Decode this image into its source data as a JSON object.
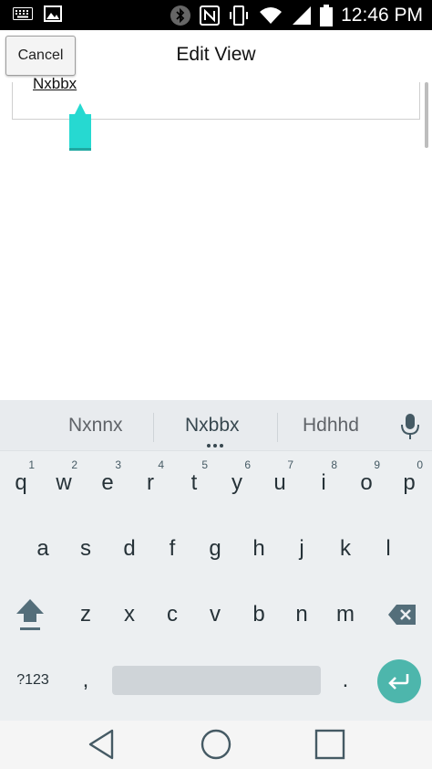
{
  "status_bar": {
    "time": "12:46 PM",
    "icons": [
      "keyboard-icon",
      "image-icon",
      "bluetooth-icon",
      "nfc-icon",
      "vibrate-icon",
      "wifi-icon",
      "signal-icon",
      "battery-icon"
    ]
  },
  "header": {
    "cancel_label": "Cancel",
    "title": "Edit View"
  },
  "editor": {
    "text": "Nxbbx"
  },
  "keyboard": {
    "suggestions": [
      "Nxnnx",
      "Nxbbx",
      "Hdhhd"
    ],
    "row1": [
      {
        "key": "q",
        "hint": "1"
      },
      {
        "key": "w",
        "hint": "2"
      },
      {
        "key": "e",
        "hint": "3"
      },
      {
        "key": "r",
        "hint": "4"
      },
      {
        "key": "t",
        "hint": "5"
      },
      {
        "key": "y",
        "hint": "6"
      },
      {
        "key": "u",
        "hint": "7"
      },
      {
        "key": "i",
        "hint": "8"
      },
      {
        "key": "o",
        "hint": "9"
      },
      {
        "key": "p",
        "hint": "0"
      }
    ],
    "row2": [
      "a",
      "s",
      "d",
      "f",
      "g",
      "h",
      "j",
      "k",
      "l"
    ],
    "row3": [
      "z",
      "x",
      "c",
      "v",
      "b",
      "n",
      "m"
    ],
    "symbols_label": "?123",
    "comma": ",",
    "period": ".",
    "accent_color": "#4db6ac"
  },
  "nav_bar": {
    "icons": [
      "back-icon",
      "home-icon",
      "recents-icon"
    ]
  }
}
